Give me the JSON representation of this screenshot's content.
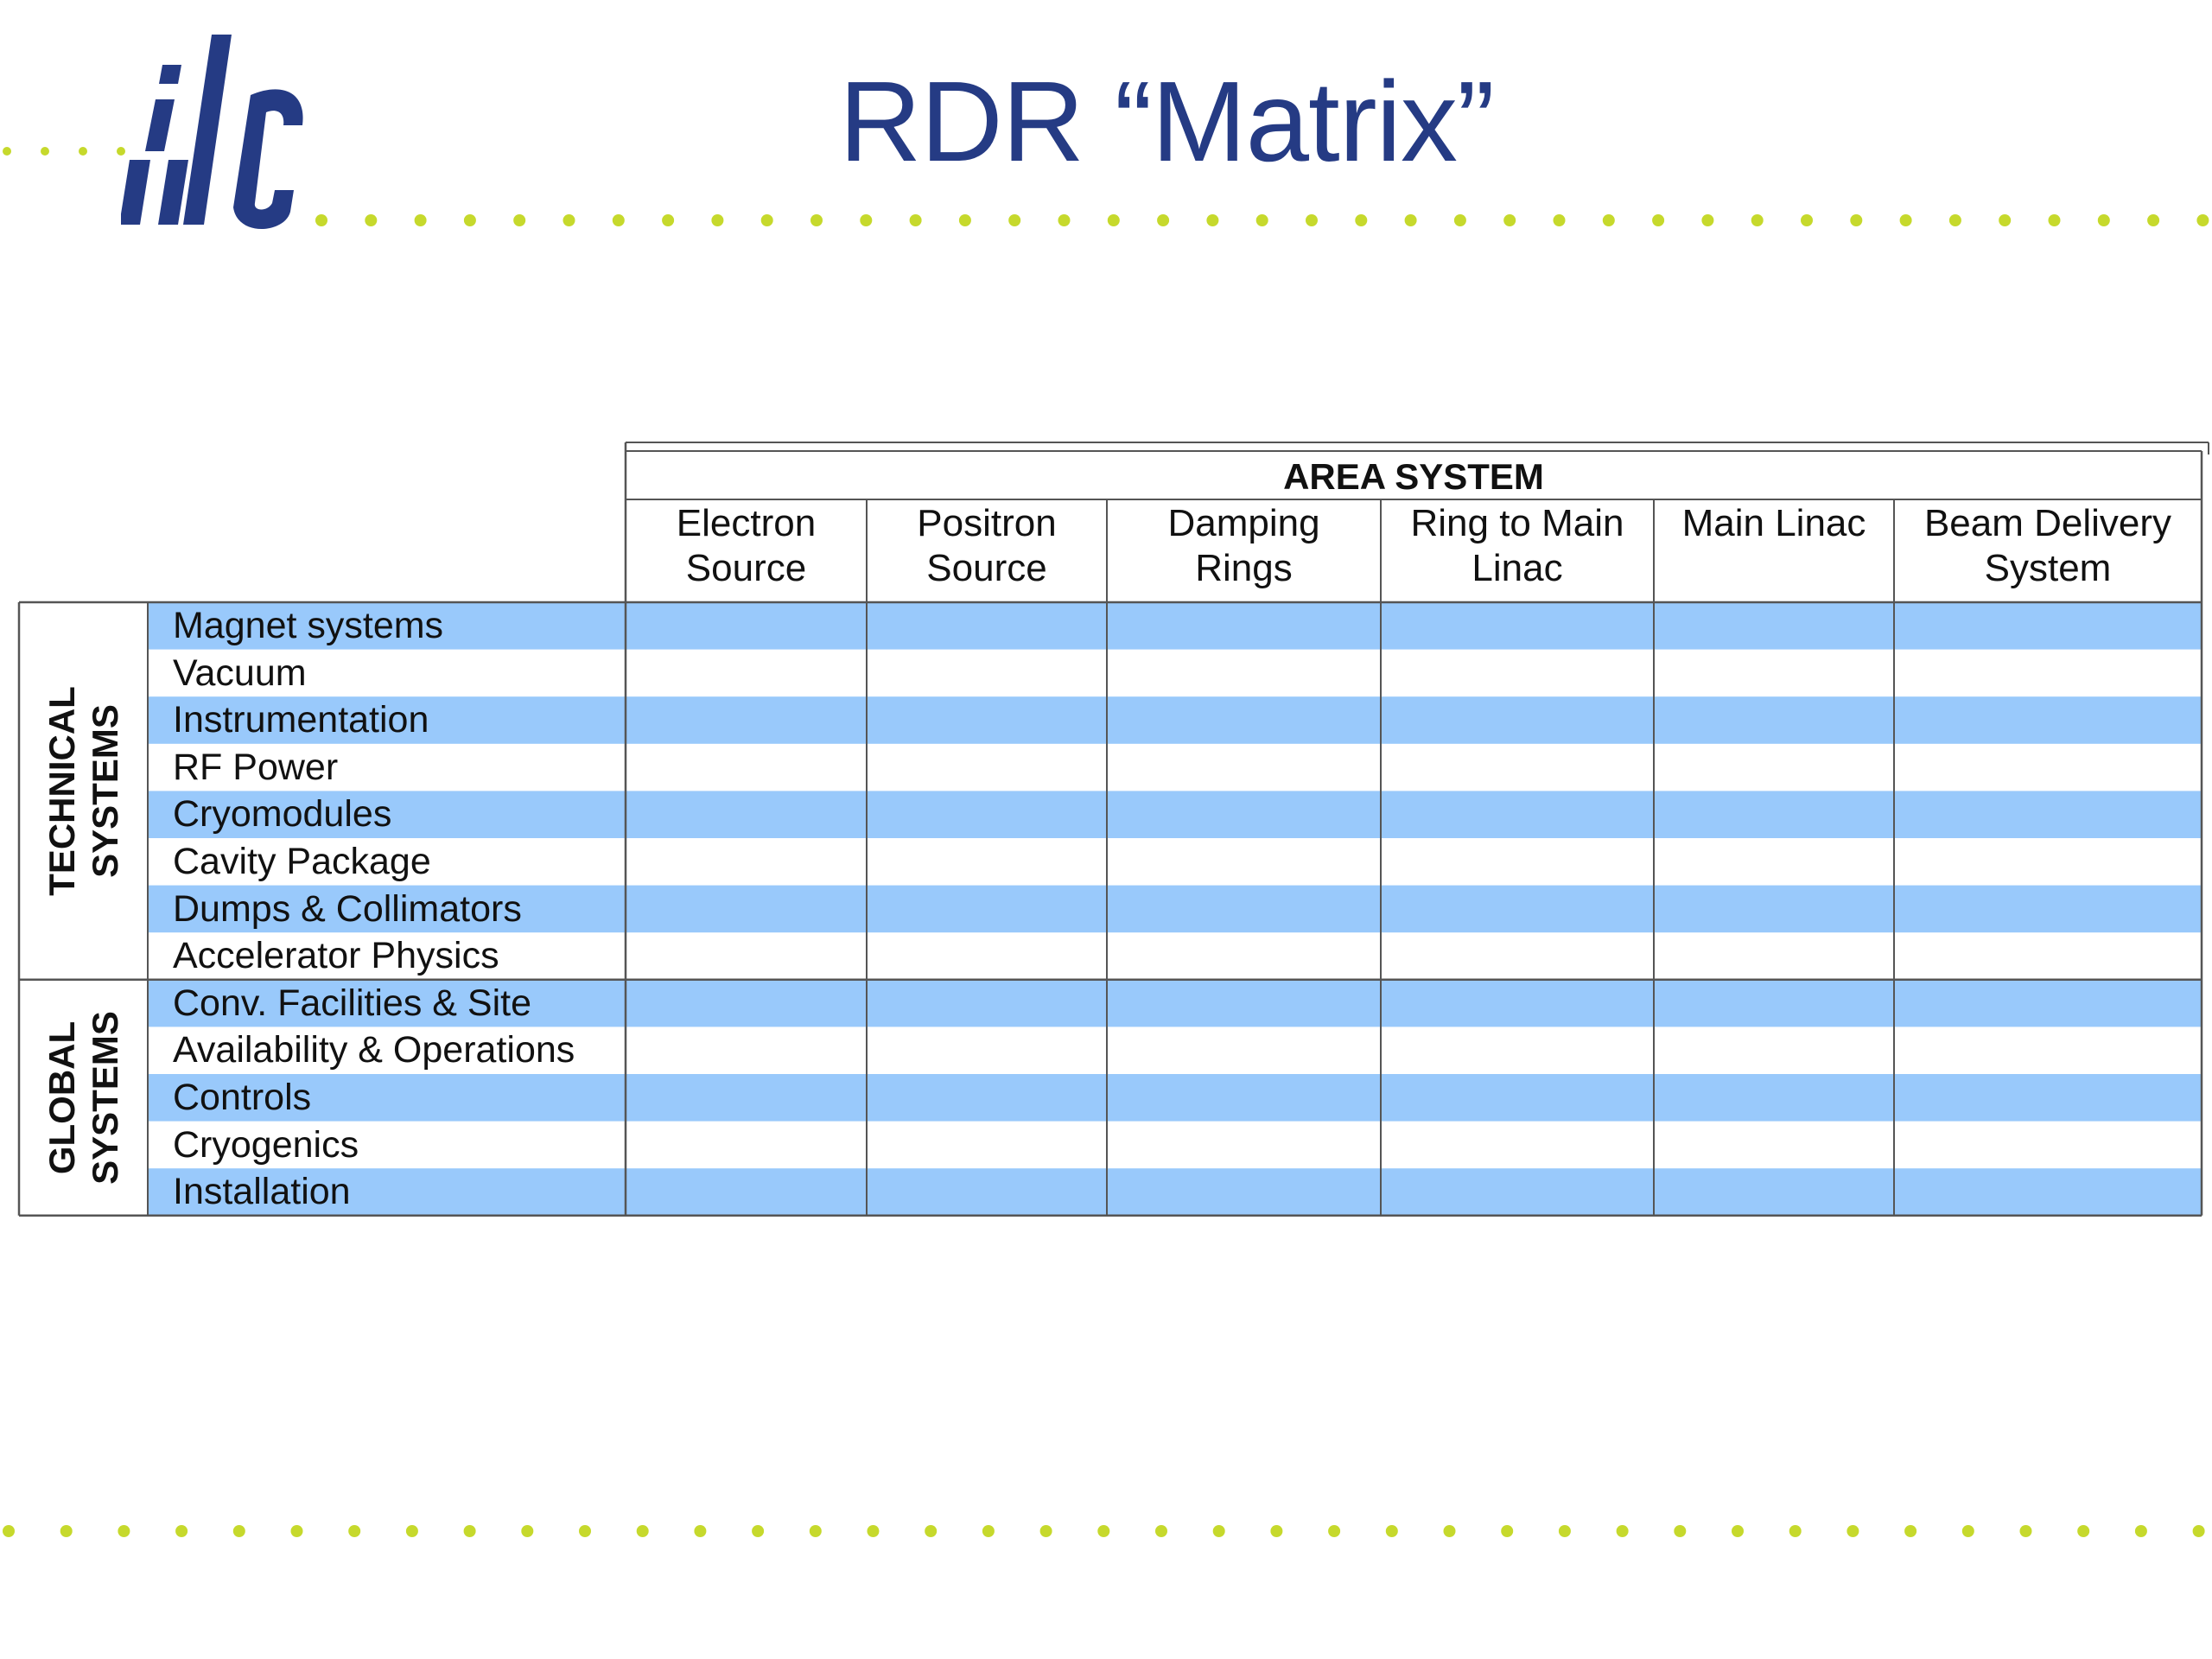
{
  "title": "RDR “Matrix”",
  "logo": {
    "text": "ilc"
  },
  "colors": {
    "title": "#253b84",
    "logo": "#253b84",
    "dots": "#c6d92c",
    "stripe": "#99c9fb"
  },
  "matrix": {
    "area_header": "AREA SYSTEM",
    "columns": [
      {
        "line1": "Electron",
        "line2": "Source"
      },
      {
        "line1": "Positron",
        "line2": "Source"
      },
      {
        "line1": "Damping",
        "line2": "Rings"
      },
      {
        "line1": "Ring to Main",
        "line2": "Linac"
      },
      {
        "line1": "Main Linac",
        "line2": ""
      },
      {
        "line1": "Beam Delivery",
        "line2": "System"
      }
    ],
    "groups": [
      {
        "line1": "TECHNICAL",
        "line2": "SYSTEMS"
      },
      {
        "line1": "GLOBAL",
        "line2": "SYSTEMS"
      }
    ],
    "rows": [
      "Magnet systems",
      "Vacuum",
      "Instrumentation",
      "RF Power",
      "Cryomodules",
      "Cavity Package",
      "Dumps & Collimators",
      "Accelerator Physics",
      "Conv. Facilities & Site",
      "Availability & Operations",
      "Controls",
      "Cryogenics",
      "Installation"
    ]
  }
}
